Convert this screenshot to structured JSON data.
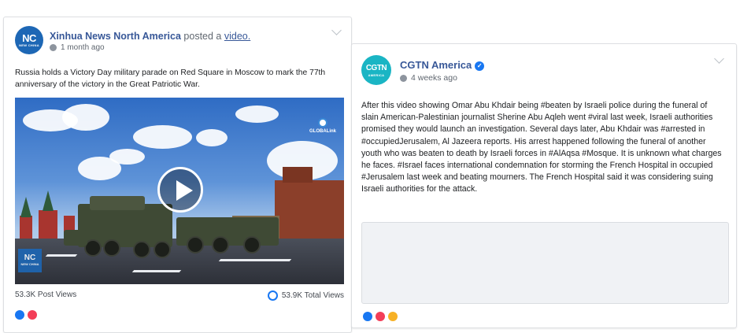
{
  "post1": {
    "page_name": "Xinhua News North America",
    "posted_prefix": "posted a",
    "posted_link": "video.",
    "time": "1 month ago",
    "avatar_text": "NC",
    "avatar_subtext": "NEW CHINA",
    "text": "Russia holds a Victory Day military parade on Red Square in Moscow to mark the 77th anniversary of the victory in the Great Patriotic War.",
    "video_logo_text": "GLOBALink",
    "watermark_text": "NC",
    "watermark_subtext": "NEW CHINA",
    "post_views": "53.3K Post Views",
    "total_views": "53.9K Total Views"
  },
  "post2": {
    "page_name": "CGTN America",
    "verified": true,
    "time": "4 weeks ago",
    "avatar_text": "CGTN",
    "avatar_subtext": "AMERICA",
    "text": "After this video showing Omar Abu Khdair being #beaten by Israeli police during the funeral of slain American-Palestinian journalist Sherine Abu Aqleh went #viral last week, Israeli authorities promised they would launch an investigation. Several days later, Abu Khdair was #arrested in #occupiedJerusalem, Al Jazeera reports. His arrest happened following the funeral of another youth who was beaten to death by Israeli forces in #AlAqsa #Mosque. It is unknown what charges he faces. #Israel faces international condemnation for storming the French Hospital in occupied #Jerusalem last week and beating mourners. The French Hospital said it was considering suing Israeli authorities for the attack."
  },
  "icons": {
    "globe": "globe-icon",
    "chevron": "chevron-down-icon",
    "play": "play-icon",
    "verified": "verified-badge-icon",
    "views": "views-icon"
  },
  "colors": {
    "link": "#385898",
    "xinhua_blue": "#1d67b5",
    "cgtn_teal": "#1ab5c4",
    "verified_blue": "#1877f2"
  }
}
